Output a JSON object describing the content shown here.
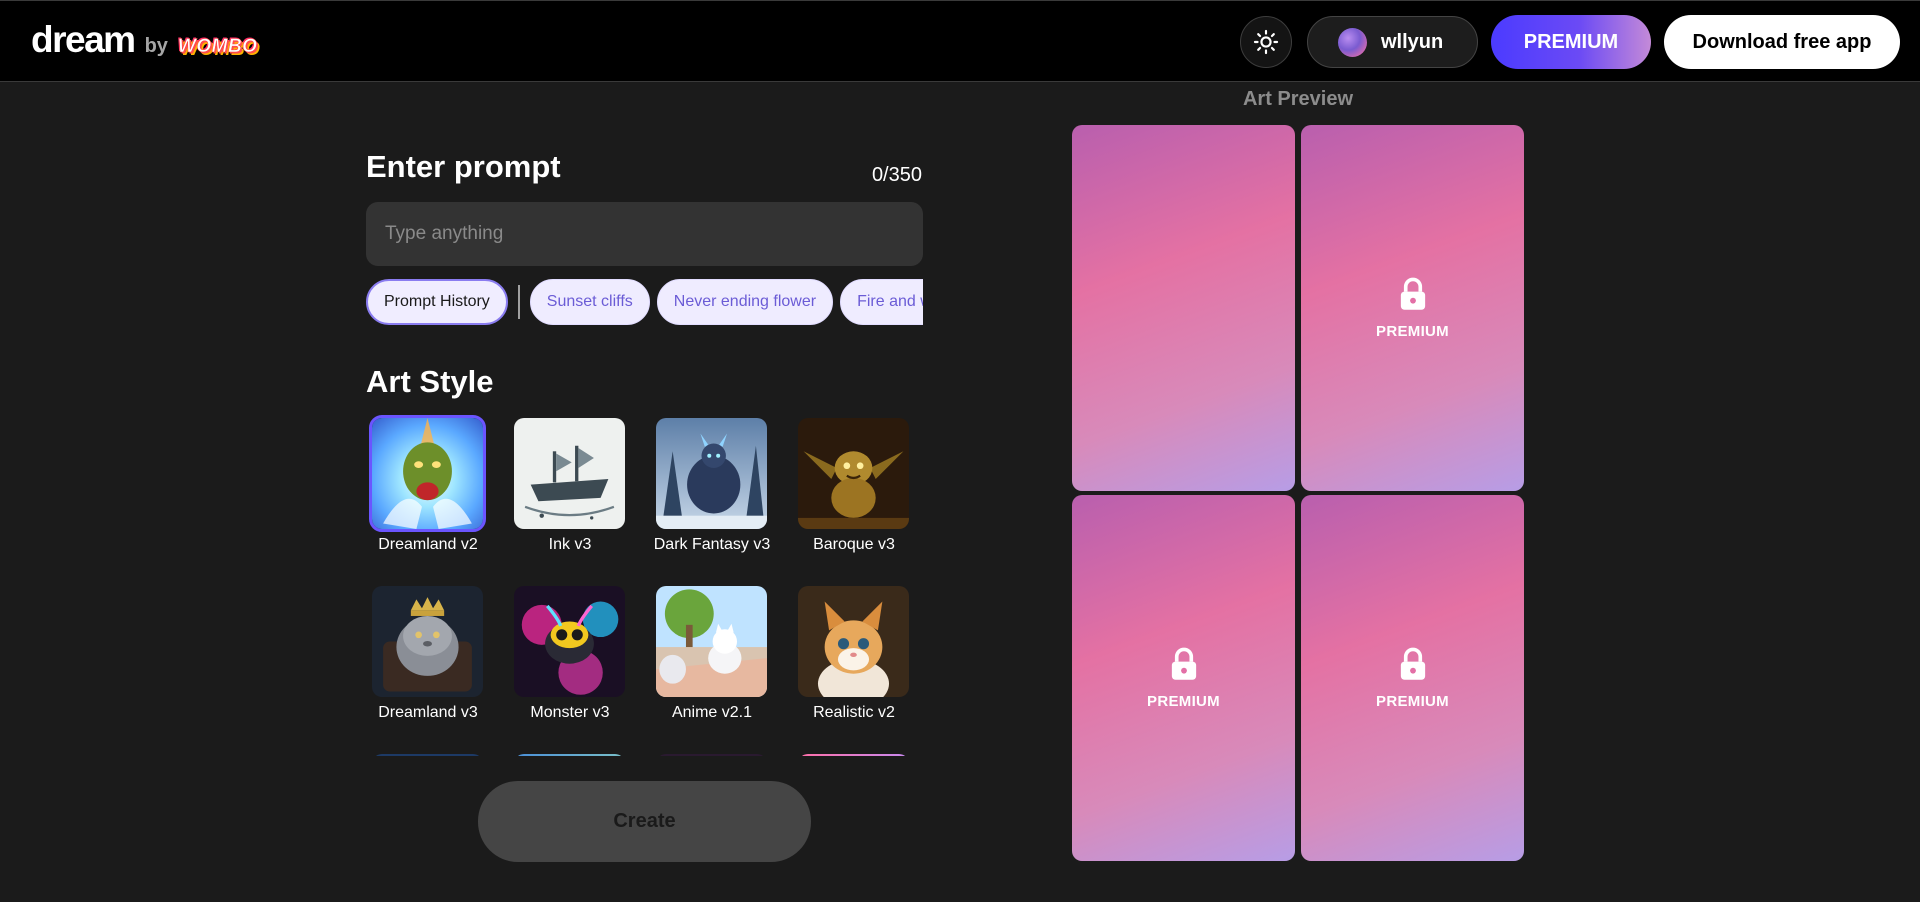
{
  "header": {
    "logo_text": "dream",
    "logo_by": "by",
    "logo_brand": "WOMBO",
    "user_name": "wllyun",
    "premium_label": "PREMIUM",
    "download_label": "Download free app"
  },
  "prompt": {
    "title": "Enter prompt",
    "char_count": "0/350",
    "placeholder": "Type anything",
    "value": ""
  },
  "chips": {
    "history_label": "Prompt History",
    "suggestions": [
      "Sunset cliffs",
      "Never ending flower",
      "Fire and water"
    ]
  },
  "art_style": {
    "title": "Art Style",
    "styles": [
      {
        "label": "Dreamland v2",
        "selected": true
      },
      {
        "label": "Ink v3",
        "selected": false
      },
      {
        "label": "Dark Fantasy v3",
        "selected": false
      },
      {
        "label": "Baroque v3",
        "selected": false
      },
      {
        "label": "Dreamland v3",
        "selected": false
      },
      {
        "label": "Monster v3",
        "selected": false
      },
      {
        "label": "Anime v2.1",
        "selected": false
      },
      {
        "label": "Realistic v2",
        "selected": false
      }
    ]
  },
  "create_label": "Create",
  "preview": {
    "title": "Art Preview",
    "cards": [
      {
        "locked": false,
        "label": ""
      },
      {
        "locked": true,
        "label": "PREMIUM"
      },
      {
        "locked": true,
        "label": "PREMIUM"
      },
      {
        "locked": true,
        "label": "PREMIUM"
      }
    ]
  },
  "colors": {
    "accent": "#6b55ff",
    "premium_gradient_start": "#4b3bff",
    "premium_gradient_end": "#c48ad8",
    "chip_text": "#6b5cd6"
  }
}
